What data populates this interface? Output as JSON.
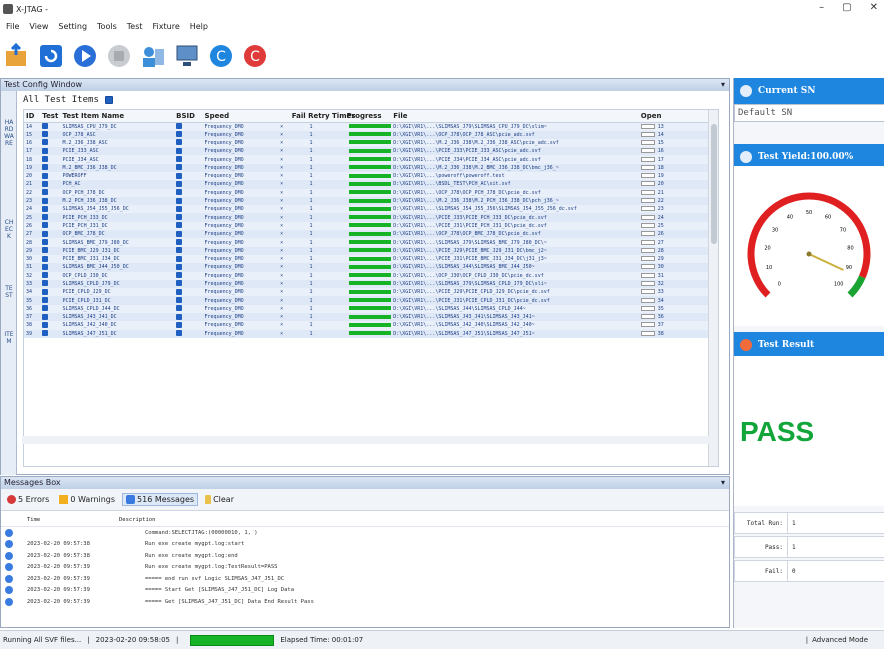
{
  "window": {
    "title": "X-JTAG -",
    "controls": [
      "–",
      "▢",
      "✕"
    ]
  },
  "menu": [
    "File",
    "View",
    "Setting",
    "Tools",
    "Test",
    "Fixture",
    "Help"
  ],
  "toolbar": [
    "open-folder-icon",
    "reload-icon",
    "play-icon",
    "stop-icon",
    "user-config-icon",
    "computer-icon",
    "refresh-icon",
    "power-icon"
  ],
  "config": {
    "title": "Test Config Window",
    "all_items": "All Test Items",
    "side_tabs": [
      "HARDWARE",
      "CHECK",
      "TEST",
      "ITEM"
    ],
    "columns": [
      "ID",
      "Test",
      "Test Item Name",
      "BSID",
      "Speed",
      "Fail Retry Times",
      "Progress",
      "File",
      "Open"
    ],
    "rows": [
      [
        "14",
        "SLIMSAS_CPU_J79_DC",
        "Frequency_DMO",
        "1",
        "D:\\XGI\\VR1\\...\\SLIMSAS_J79\\SLIMSAS_CPU_J79_DC\\slim~",
        "13"
      ],
      [
        "15",
        "OCP_J78_ASC",
        "Frequency_DMO",
        "1",
        "D:\\XGI\\VR1\\...\\OCP_J78\\OCP_J78_ASC\\pcie_adc.svf",
        "14"
      ],
      [
        "16",
        "M.2_J36_J38_ASC",
        "Frequency_DMO",
        "1",
        "D:\\XGI\\VR1\\...\\M.2_J36_J38\\M.2_J36_J38_ASC\\pcie_adc.svf",
        "15"
      ],
      [
        "17",
        "PCIE_J33_ASC",
        "Frequency_DMO",
        "1",
        "D:\\XGI\\VR1\\...\\PCIE_J33\\PCIE_J33_ASC\\pcie_adc.svf",
        "16"
      ],
      [
        "18",
        "PCIE_J34_ASC",
        "Frequency_DMO",
        "1",
        "D:\\XGI\\VR1\\...\\PCIE_J34\\PCIE_J34_ASC\\pcie_adc.svf",
        "17"
      ],
      [
        "19",
        "M.2_BMC_J36_J38_DC",
        "Frequency_DMO",
        "1",
        "D:\\XGI\\VR1\\...\\M.2_J36_J38\\M.2_BMC_J36_J38_DC\\bmc_j36_~",
        "18"
      ],
      [
        "20",
        "POWEROFF",
        "Frequency_DMO",
        "1",
        "D:\\XGI\\VR1\\...\\poweroff\\poweroff.test",
        "19"
      ],
      [
        "21",
        "PCH_AC",
        "Frequency_DMO",
        "1",
        "D:\\XGI\\VR1\\...\\BSDL_TEST\\PCH_AC\\xit.svf",
        "20"
      ],
      [
        "22",
        "OCP_PCH_J78_DC",
        "Frequency_DMO",
        "1",
        "D:\\XGI\\VR1\\...\\OCP_J78\\OCP_PCH_J78_DC\\pcie_dc.svf",
        "21"
      ],
      [
        "23",
        "M.2_PCH_J36_J38_DC",
        "Frequency_DMO",
        "1",
        "D:\\XGI\\VR1\\...\\M.2_J36_J38\\M.2_PCH_J36_J38_DC\\pch_j36_~",
        "22"
      ],
      [
        "24",
        "SLIMSAS_J54_J55_J56_DC",
        "Frequency_DMO",
        "1",
        "D:\\XGI\\VR1\\...\\SLIMSAS_J54_J55_J56\\SLIMSAS_J54_J55_J56_dc.svf",
        "23"
      ],
      [
        "25",
        "PCIE_PCH_J33_DC",
        "Frequency_DMO",
        "1",
        "D:\\XGI\\VR1\\...\\PCIE_J33\\PCIE_PCH_J33_DC\\pcie_dc.svf",
        "24"
      ],
      [
        "26",
        "PCIE_PCH_J31_DC",
        "Frequency_DMO",
        "1",
        "D:\\XGI\\VR1\\...\\PCIE_J31\\PCIE_PCH_J31_DC\\pcie_dc.svf",
        "25"
      ],
      [
        "27",
        "OCP_BMC_J78_DC",
        "Frequency_DMO",
        "1",
        "D:\\XGI\\VR1\\...\\OCP_J78\\OCP_BMC_J78_DC\\pcie_dc.svf",
        "26"
      ],
      [
        "28",
        "SLIMSAS_BMC_J79_J80_DC",
        "Frequency_DMO",
        "1",
        "D:\\XGI\\VR1\\...\\SLIMSAS_J79\\SLIMSAS_BMC_J79_J80_DC\\~",
        "27"
      ],
      [
        "29",
        "PCIE_BMC_J29_J31_DC",
        "Frequency_DMO",
        "1",
        "D:\\XGI\\VR1\\...\\PCIE_J29\\PCIE_BMC_J29_J31_DC\\bmc_j2~",
        "28"
      ],
      [
        "30",
        "PCIE_BMC_J31_J34_DC",
        "Frequency_DMO",
        "1",
        "D:\\XGI\\VR1\\...\\PCIE_J31\\PCIE_BMC_J31_J34_DC\\j31_j3~",
        "29"
      ],
      [
        "31",
        "SLIMSAS_BMC_J44_J50_DC",
        "Frequency_DMO",
        "1",
        "D:\\XGI\\VR1\\...\\SLIMSAS_J44\\SLIMSAS_BMC_J44_J50~",
        "30"
      ],
      [
        "32",
        "OCP_CPLD_J30_DC",
        "Frequency_DMO",
        "1",
        "D:\\XGI\\VR1\\...\\OCP_J30\\OCP_CPLD_J30_DC\\pcie_dc.svf",
        "31"
      ],
      [
        "33",
        "SLIMSAS_CPLD_J79_DC",
        "Frequency_DMO",
        "1",
        "D:\\XGI\\VR1\\...\\SLIMSAS_J79\\SLIMSAS_CPLD_J79_DC\\sli~",
        "32"
      ],
      [
        "34",
        "PCIE_CPLD_J29_DC",
        "Frequency_DMO",
        "1",
        "D:\\XGI\\VR1\\...\\PCIE_J29\\PCIE_CPLD_J29_DC\\pcie_dc.svf",
        "33"
      ],
      [
        "35",
        "PCIE_CPLD_J31_DC",
        "Frequency_DMO",
        "1",
        "D:\\XGI\\VR1\\...\\PCIE_J31\\PCIE_CPLD_J31_DC\\pcie_dc.svf",
        "34"
      ],
      [
        "36",
        "SLIMSAS_CPLD_J44_DC",
        "Frequency_DMO",
        "1",
        "D:\\XGI\\VR1\\...\\SLIMSAS_J44\\SLIMSAS_CPLD_J44~",
        "35"
      ],
      [
        "37",
        "SLIMSAS_J43_J41_DC",
        "Frequency_DMO",
        "1",
        "D:\\XGI\\VR1\\...\\SLIMSAS_J43_J41\\SLIMSAS_J43_J41~",
        "36"
      ],
      [
        "38",
        "SLIMSAS_J42_J40_DC",
        "Frequency_DMO",
        "1",
        "D:\\XGI\\VR1\\...\\SLIMSAS_J42_J40\\SLIMSAS_J42_J40~",
        "37"
      ],
      [
        "39",
        "SLIMSAS_J47_J51_DC",
        "Frequency_DMO",
        "1",
        "D:\\XGI\\VR1\\...\\SLIMSAS_J47_J51\\SLIMSAS_J47_J51~",
        "38"
      ]
    ]
  },
  "right": {
    "current_sn_title": "Current SN",
    "sn_value": "Default SN",
    "yield_title": "Test Yield:100.00%",
    "gauge": {
      "value": 100,
      "ticks": [
        "0",
        "10",
        "20",
        "30",
        "40",
        "50",
        "60",
        "70",
        "80",
        "90",
        "100"
      ]
    },
    "result_title": "Test Result",
    "result": "PASS",
    "stats": [
      {
        "label": "Total Run:",
        "value": "1"
      },
      {
        "label": "Pass:",
        "value": "1"
      },
      {
        "label": "Fail:",
        "value": "0"
      }
    ]
  },
  "messages": {
    "title": "Messages Box",
    "tabs": {
      "errors": "5 Errors",
      "warnings": "0 Warnings",
      "messages": "516 Messages",
      "clear": "Clear"
    },
    "head": {
      "time": "Time",
      "desc": "Description"
    },
    "rows": [
      {
        "time": "",
        "desc": "Command:SELECTJTAG:(00000010, 1, )"
      },
      {
        "time": "2023-02-20 09:57:38",
        "desc": "Run exe create mygpt.log:start"
      },
      {
        "time": "2023-02-20 09:57:38",
        "desc": "Run exe create mygpt.log:end"
      },
      {
        "time": "2023-02-20 09:57:39",
        "desc": "Run exe create mygpt.log:TestResult=PASS"
      },
      {
        "time": "2023-02-20 09:57:39",
        "desc": "===== end run svf Logic SLIMSAS_J47_J51_DC"
      },
      {
        "time": "2023-02-20 09:57:39",
        "desc": "===== Start Get [SLIMSAS_J47_J51_DC] Log Data"
      },
      {
        "time": "2023-02-20 09:57:39",
        "desc": "===== Get [SLIMSAS_J47_J51_DC] Data End Result Pass"
      }
    ]
  },
  "status": {
    "left": "Running All SVF files...",
    "datetime": "2023-02-20 09:58:05",
    "elapsed": "Elapsed Time: 00:01:07",
    "mode": "Advanced Mode"
  }
}
